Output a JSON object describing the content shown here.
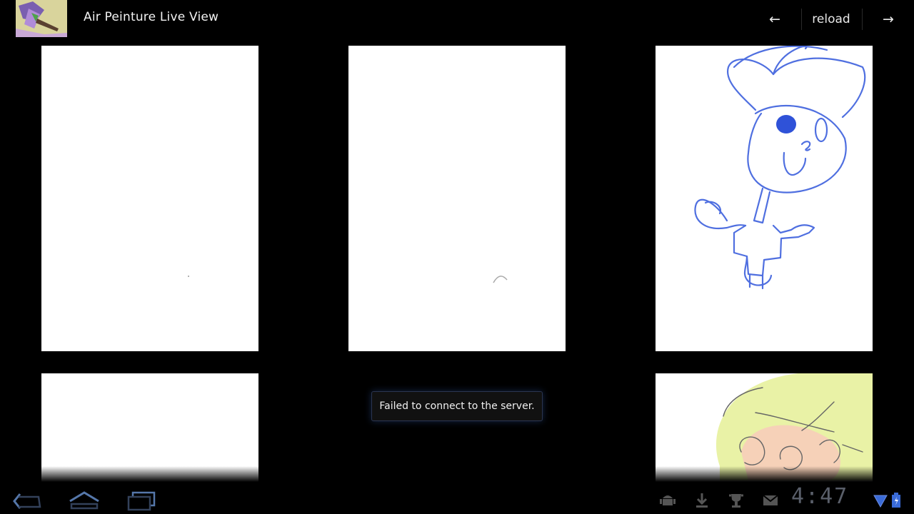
{
  "app": {
    "title": "Air Peinture Live View",
    "icon": "app-thumbnail-icon"
  },
  "actionbar": {
    "prev_label": "←",
    "reload_label": "reload",
    "next_label": "→"
  },
  "gallery": {
    "items": [
      {
        "name": "drawing-1",
        "content": "blank"
      },
      {
        "name": "drawing-2",
        "content": "small-arc-stroke"
      },
      {
        "name": "drawing-3",
        "content": "blue-figure-drawing"
      },
      {
        "name": "drawing-4",
        "content": "blank"
      },
      {
        "name": "drawing-5",
        "content": "yellow-orange-figure-drawing"
      }
    ]
  },
  "toast": {
    "message": "Failed to connect to the server."
  },
  "systembar": {
    "nav": [
      "back-icon",
      "home-icon",
      "recent-apps-icon"
    ],
    "status_icons": [
      "android-debug-icon",
      "download-icon",
      "trophy-icon",
      "gmail-icon",
      "wifi-icon",
      "battery-charging-icon"
    ],
    "time": "4:47"
  },
  "colors": {
    "background": "#000000",
    "accent_blue": "#4a6cf0",
    "clock": "#5a5f6a"
  }
}
